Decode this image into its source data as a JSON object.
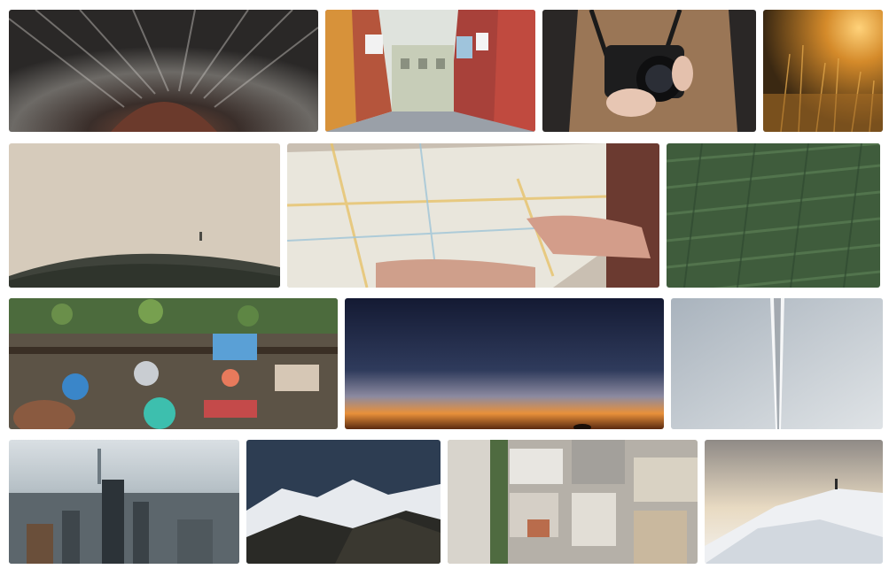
{
  "gallery": {
    "photos": [
      {
        "subject": "brick-tunnel"
      },
      {
        "subject": "colorful-street-with-laundry"
      },
      {
        "subject": "person-holding-camera"
      },
      {
        "subject": "golden-grass-sunset"
      },
      {
        "subject": "foggy-hill-with-figure"
      },
      {
        "subject": "hand-holding-map"
      },
      {
        "subject": "green-crop-field"
      },
      {
        "subject": "floating-market-boat"
      },
      {
        "subject": "twilight-horizon"
      },
      {
        "subject": "waterfall-or-tornado-mist"
      },
      {
        "subject": "city-skyline-aerial"
      },
      {
        "subject": "snowy-mountains"
      },
      {
        "subject": "city-rooftops-aerial"
      },
      {
        "subject": "hiker-on-snowy-peak"
      }
    ]
  }
}
